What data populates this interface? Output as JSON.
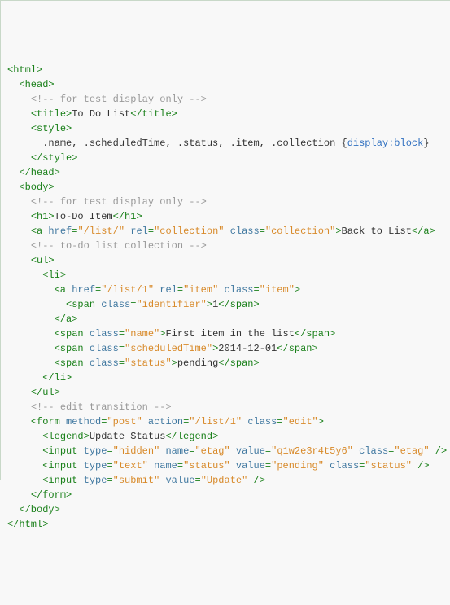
{
  "code": {
    "lines": [
      {
        "indent": 0,
        "parts": [
          {
            "cls": "t",
            "txt": "<html>"
          }
        ]
      },
      {
        "indent": 1,
        "parts": [
          {
            "cls": "t",
            "txt": "<head>"
          }
        ]
      },
      {
        "indent": 2,
        "parts": [
          {
            "cls": "c",
            "txt": "<!-- for test display only -->"
          }
        ]
      },
      {
        "indent": 2,
        "parts": [
          {
            "cls": "t",
            "txt": "<title>"
          },
          {
            "cls": "x",
            "txt": "To Do List"
          },
          {
            "cls": "t",
            "txt": "</title>"
          }
        ]
      },
      {
        "indent": 2,
        "parts": [
          {
            "cls": "t",
            "txt": "<style>"
          }
        ]
      },
      {
        "indent": 3,
        "parts": [
          {
            "cls": "x",
            "txt": ".name, .scheduledTime, .status, .item, .collection {"
          },
          {
            "cls": "hl",
            "txt": "display:block"
          },
          {
            "cls": "x",
            "txt": "}"
          }
        ]
      },
      {
        "indent": 2,
        "parts": [
          {
            "cls": "t",
            "txt": "</style>"
          }
        ]
      },
      {
        "indent": 1,
        "parts": [
          {
            "cls": "t",
            "txt": "</head>"
          }
        ]
      },
      {
        "indent": 1,
        "parts": [
          {
            "cls": "t",
            "txt": "<body>"
          }
        ]
      },
      {
        "indent": 2,
        "parts": [
          {
            "cls": "c",
            "txt": "<!-- for test display only -->"
          }
        ]
      },
      {
        "indent": 2,
        "parts": [
          {
            "cls": "t",
            "txt": "<h1>"
          },
          {
            "cls": "x",
            "txt": "To-Do Item"
          },
          {
            "cls": "t",
            "txt": "</h1>"
          }
        ]
      },
      {
        "indent": 2,
        "parts": [
          {
            "cls": "t",
            "txt": "<a "
          },
          {
            "cls": "a",
            "txt": "href"
          },
          {
            "cls": "t",
            "txt": "="
          },
          {
            "cls": "s",
            "txt": "\"/list/\""
          },
          {
            "cls": "t",
            "txt": " "
          },
          {
            "cls": "a",
            "txt": "rel"
          },
          {
            "cls": "t",
            "txt": "="
          },
          {
            "cls": "s",
            "txt": "\"collection\""
          },
          {
            "cls": "t",
            "txt": " "
          },
          {
            "cls": "a",
            "txt": "class"
          },
          {
            "cls": "t",
            "txt": "="
          },
          {
            "cls": "s",
            "txt": "\"collection\""
          },
          {
            "cls": "t",
            "txt": ">"
          },
          {
            "cls": "x",
            "txt": "Back to List"
          },
          {
            "cls": "t",
            "txt": "</a>"
          }
        ]
      },
      {
        "indent": 2,
        "parts": [
          {
            "cls": "c",
            "txt": "<!-- to-do list collection -->"
          }
        ]
      },
      {
        "indent": 2,
        "parts": [
          {
            "cls": "t",
            "txt": "<ul>"
          }
        ]
      },
      {
        "indent": 3,
        "parts": [
          {
            "cls": "t",
            "txt": "<li>"
          }
        ]
      },
      {
        "indent": 4,
        "parts": [
          {
            "cls": "t",
            "txt": "<a "
          },
          {
            "cls": "a",
            "txt": "href"
          },
          {
            "cls": "t",
            "txt": "="
          },
          {
            "cls": "s",
            "txt": "\"/list/1\""
          },
          {
            "cls": "t",
            "txt": " "
          },
          {
            "cls": "a",
            "txt": "rel"
          },
          {
            "cls": "t",
            "txt": "="
          },
          {
            "cls": "s",
            "txt": "\"item\""
          },
          {
            "cls": "t",
            "txt": " "
          },
          {
            "cls": "a",
            "txt": "class"
          },
          {
            "cls": "t",
            "txt": "="
          },
          {
            "cls": "s",
            "txt": "\"item\""
          },
          {
            "cls": "t",
            "txt": ">"
          }
        ]
      },
      {
        "indent": 5,
        "parts": [
          {
            "cls": "t",
            "txt": "<span "
          },
          {
            "cls": "a",
            "txt": "class"
          },
          {
            "cls": "t",
            "txt": "="
          },
          {
            "cls": "s",
            "txt": "\"identifier\""
          },
          {
            "cls": "t",
            "txt": ">"
          },
          {
            "cls": "x",
            "txt": "1"
          },
          {
            "cls": "t",
            "txt": "</span>"
          }
        ]
      },
      {
        "indent": 4,
        "parts": [
          {
            "cls": "t",
            "txt": "</a>"
          }
        ]
      },
      {
        "indent": 4,
        "parts": [
          {
            "cls": "t",
            "txt": "<span "
          },
          {
            "cls": "a",
            "txt": "class"
          },
          {
            "cls": "t",
            "txt": "="
          },
          {
            "cls": "s",
            "txt": "\"name\""
          },
          {
            "cls": "t",
            "txt": ">"
          },
          {
            "cls": "x",
            "txt": "First item in the list"
          },
          {
            "cls": "t",
            "txt": "</span>"
          }
        ]
      },
      {
        "indent": 4,
        "parts": [
          {
            "cls": "t",
            "txt": "<span "
          },
          {
            "cls": "a",
            "txt": "class"
          },
          {
            "cls": "t",
            "txt": "="
          },
          {
            "cls": "s",
            "txt": "\"scheduledTime\""
          },
          {
            "cls": "t",
            "txt": ">"
          },
          {
            "cls": "x",
            "txt": "2014-12-01"
          },
          {
            "cls": "t",
            "txt": "</span>"
          }
        ]
      },
      {
        "indent": 4,
        "parts": [
          {
            "cls": "t",
            "txt": "<span "
          },
          {
            "cls": "a",
            "txt": "class"
          },
          {
            "cls": "t",
            "txt": "="
          },
          {
            "cls": "s",
            "txt": "\"status\""
          },
          {
            "cls": "t",
            "txt": ">"
          },
          {
            "cls": "x",
            "txt": "pending"
          },
          {
            "cls": "t",
            "txt": "</span>"
          }
        ]
      },
      {
        "indent": 3,
        "parts": [
          {
            "cls": "t",
            "txt": "</li>"
          }
        ]
      },
      {
        "indent": 2,
        "parts": [
          {
            "cls": "t",
            "txt": "</ul>"
          }
        ]
      },
      {
        "indent": 2,
        "parts": [
          {
            "cls": "c",
            "txt": "<!-- edit transition -->"
          }
        ]
      },
      {
        "indent": 2,
        "parts": [
          {
            "cls": "t",
            "txt": "<form "
          },
          {
            "cls": "a",
            "txt": "method"
          },
          {
            "cls": "t",
            "txt": "="
          },
          {
            "cls": "s",
            "txt": "\"post\""
          },
          {
            "cls": "t",
            "txt": " "
          },
          {
            "cls": "a",
            "txt": "action"
          },
          {
            "cls": "t",
            "txt": "="
          },
          {
            "cls": "s",
            "txt": "\"/list/1\""
          },
          {
            "cls": "t",
            "txt": " "
          },
          {
            "cls": "a",
            "txt": "class"
          },
          {
            "cls": "t",
            "txt": "="
          },
          {
            "cls": "s",
            "txt": "\"edit\""
          },
          {
            "cls": "t",
            "txt": ">"
          }
        ]
      },
      {
        "indent": 3,
        "parts": [
          {
            "cls": "t",
            "txt": "<legend>"
          },
          {
            "cls": "x",
            "txt": "Update Status"
          },
          {
            "cls": "t",
            "txt": "</legend>"
          }
        ]
      },
      {
        "indent": 3,
        "parts": [
          {
            "cls": "t",
            "txt": "<input "
          },
          {
            "cls": "a",
            "txt": "type"
          },
          {
            "cls": "t",
            "txt": "="
          },
          {
            "cls": "s",
            "txt": "\"hidden\""
          },
          {
            "cls": "t",
            "txt": " "
          },
          {
            "cls": "a",
            "txt": "name"
          },
          {
            "cls": "t",
            "txt": "="
          },
          {
            "cls": "s",
            "txt": "\"etag\""
          },
          {
            "cls": "t",
            "txt": " "
          },
          {
            "cls": "a",
            "txt": "value"
          },
          {
            "cls": "t",
            "txt": "="
          },
          {
            "cls": "s",
            "txt": "\"q1w2e3r4t5y6\""
          },
          {
            "cls": "t",
            "txt": " "
          },
          {
            "cls": "a",
            "txt": "class"
          },
          {
            "cls": "t",
            "txt": "="
          },
          {
            "cls": "s",
            "txt": "\"etag\""
          },
          {
            "cls": "t",
            "txt": " />"
          }
        ]
      },
      {
        "indent": 3,
        "parts": [
          {
            "cls": "t",
            "txt": "<input "
          },
          {
            "cls": "a",
            "txt": "type"
          },
          {
            "cls": "t",
            "txt": "="
          },
          {
            "cls": "s",
            "txt": "\"text\""
          },
          {
            "cls": "t",
            "txt": " "
          },
          {
            "cls": "a",
            "txt": "name"
          },
          {
            "cls": "t",
            "txt": "="
          },
          {
            "cls": "s",
            "txt": "\"status\""
          },
          {
            "cls": "t",
            "txt": " "
          },
          {
            "cls": "a",
            "txt": "value"
          },
          {
            "cls": "t",
            "txt": "="
          },
          {
            "cls": "s",
            "txt": "\"pending\""
          },
          {
            "cls": "t",
            "txt": " "
          },
          {
            "cls": "a",
            "txt": "class"
          },
          {
            "cls": "t",
            "txt": "="
          },
          {
            "cls": "s",
            "txt": "\"status\""
          },
          {
            "cls": "t",
            "txt": " />"
          }
        ]
      },
      {
        "indent": 3,
        "parts": [
          {
            "cls": "t",
            "txt": "<input "
          },
          {
            "cls": "a",
            "txt": "type"
          },
          {
            "cls": "t",
            "txt": "="
          },
          {
            "cls": "s",
            "txt": "\"submit\""
          },
          {
            "cls": "t",
            "txt": " "
          },
          {
            "cls": "a",
            "txt": "value"
          },
          {
            "cls": "t",
            "txt": "="
          },
          {
            "cls": "s",
            "txt": "\"Update\""
          },
          {
            "cls": "t",
            "txt": " />"
          }
        ]
      },
      {
        "indent": 2,
        "parts": [
          {
            "cls": "t",
            "txt": "</form>"
          }
        ]
      },
      {
        "indent": 1,
        "parts": [
          {
            "cls": "t",
            "txt": "</body>"
          }
        ]
      },
      {
        "indent": 0,
        "parts": [
          {
            "cls": "t",
            "txt": "</html>"
          }
        ]
      }
    ]
  }
}
